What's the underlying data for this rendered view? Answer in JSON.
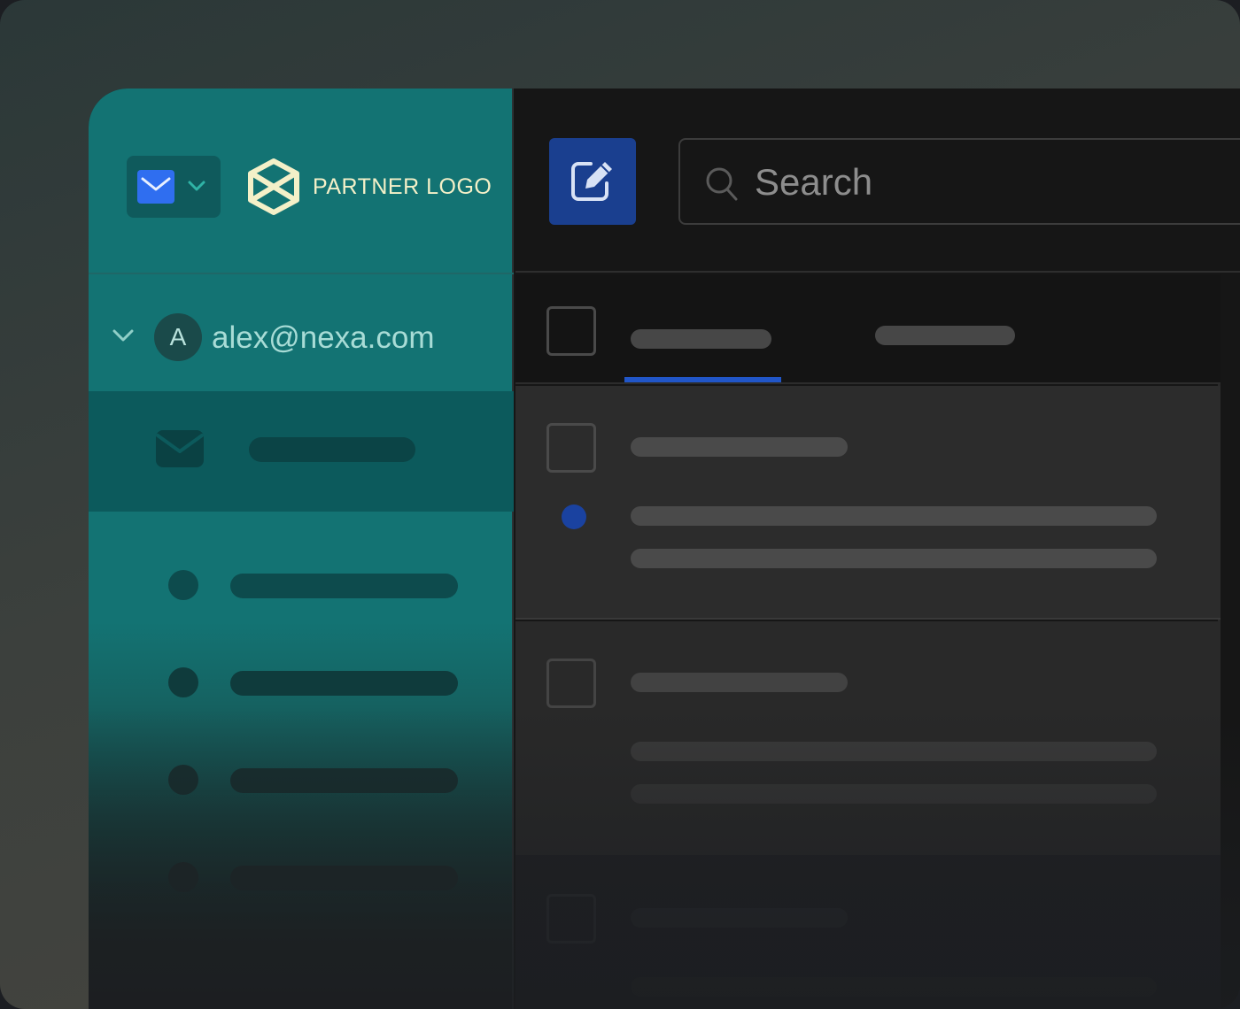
{
  "branding": {
    "partner_logo_text": "PARTNER LOGO",
    "partner_logo_color": "#f4f0c8",
    "app_icon": "mail-icon",
    "app_accent": "#2f6ef0"
  },
  "account": {
    "avatar_initial": "A",
    "email": "alex@nexa.com"
  },
  "sidebar": {
    "accent": "#137373",
    "inbox_icon": "envelope-icon"
  },
  "toolbar": {
    "compose_icon": "compose-icon",
    "compose_color": "#1a3f8f"
  },
  "search": {
    "placeholder": "Search",
    "value": ""
  },
  "message_list": {
    "active_tab_color": "#2156c8",
    "unread_dot_color": "#1a42a0"
  }
}
